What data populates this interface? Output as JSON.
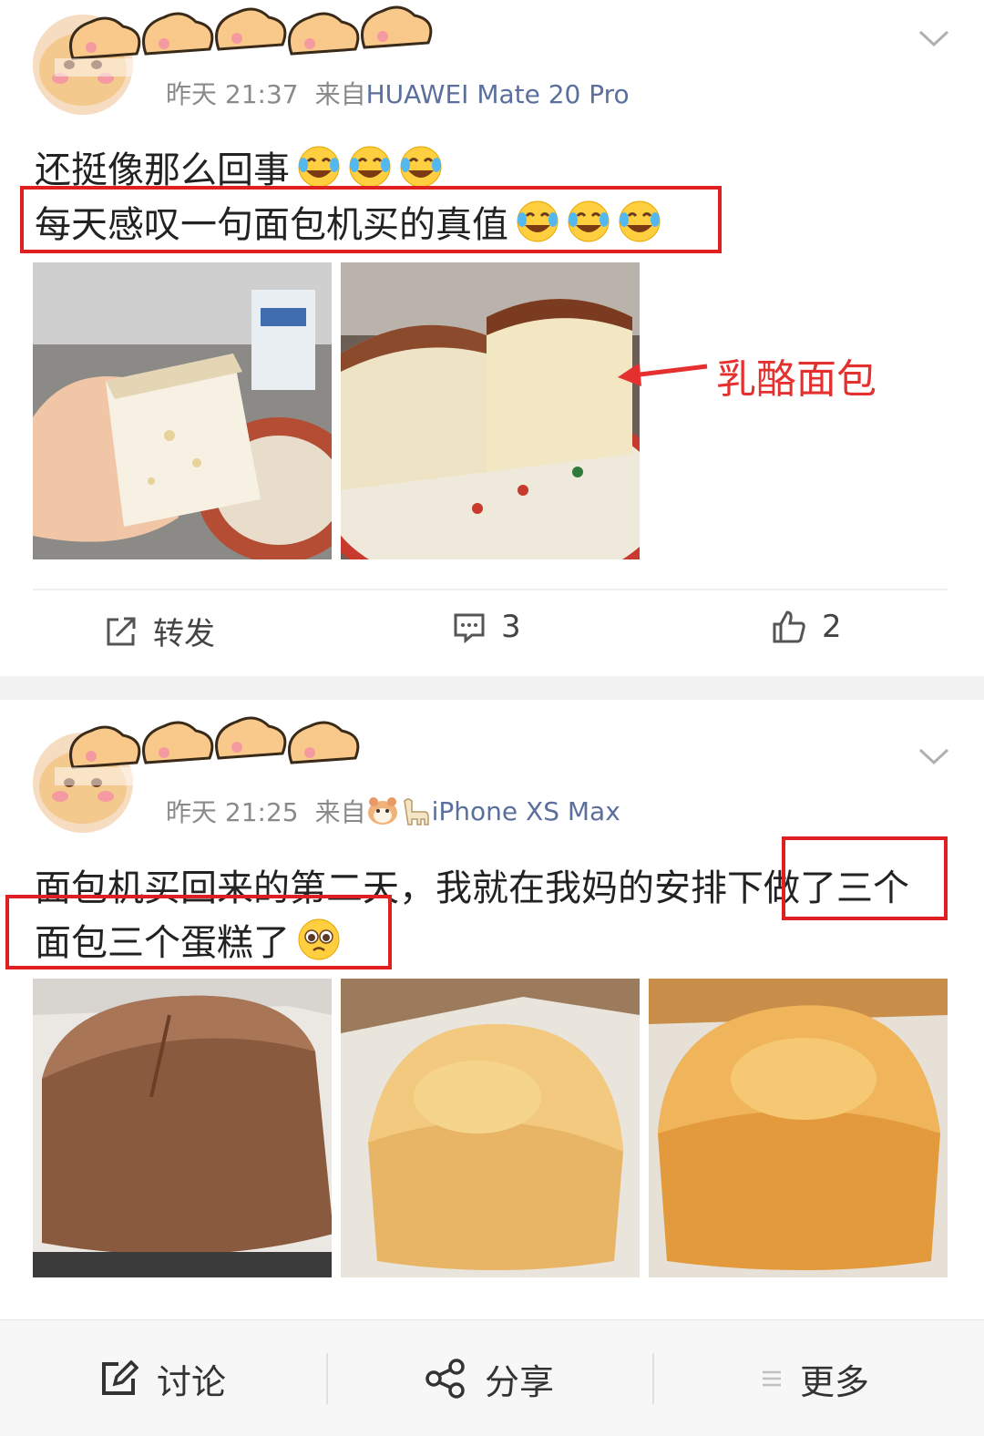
{
  "posts": [
    {
      "time": "昨天 21:37",
      "source_prefix": "来自",
      "source": "HUAWEI Mate 20 Pro",
      "lines": [
        "还挺像那么回事",
        "每天感叹一句面包机买的真值"
      ],
      "emoji_names": [
        "laugh-cry-emoji",
        "laugh-cry-emoji",
        "laugh-cry-emoji"
      ],
      "annotation": "乳酪面包",
      "actions": {
        "repost_label": "转发",
        "comment_count": "3",
        "like_count": "2"
      }
    },
    {
      "time": "昨天 21:25",
      "source_prefix": "来自",
      "source": "iPhone XS Max",
      "lines": [
        "面包机买回来的第二天，我就在我妈的安排下做了三个",
        "面包三个蛋糕了"
      ],
      "emoji_names": [
        "pleading-emoji"
      ]
    }
  ],
  "bottom_bar": {
    "discuss_label": "讨论",
    "share_label": "分享",
    "more_label": "更多"
  },
  "colors": {
    "highlight": "#e02020",
    "source_link": "#5a6f9c",
    "meta_gray": "#8a8a8a"
  }
}
